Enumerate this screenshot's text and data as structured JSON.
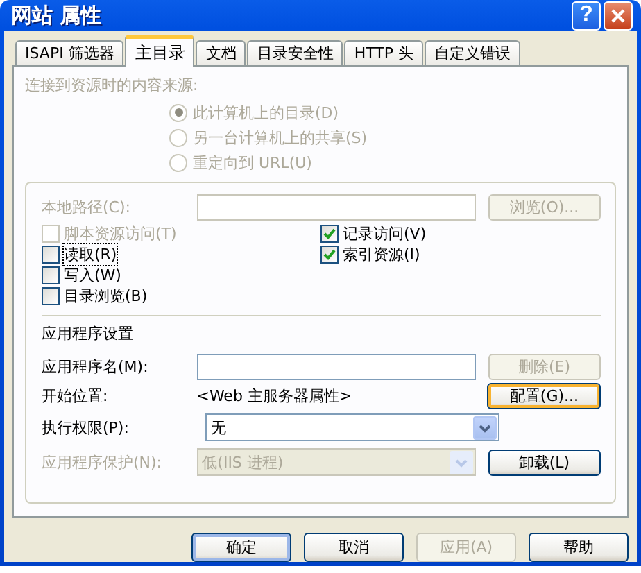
{
  "window": {
    "title": "网站 属性",
    "help_button": "?"
  },
  "tabs": [
    {
      "label": "ISAPI 筛选器",
      "selected": false
    },
    {
      "label": "主目录",
      "selected": true
    },
    {
      "label": "文档",
      "selected": false
    },
    {
      "label": "目录安全性",
      "selected": false
    },
    {
      "label": "HTTP 头",
      "selected": false
    },
    {
      "label": "自定义错误",
      "selected": false
    }
  ],
  "content_source": {
    "label": "连接到资源时的内容来源:",
    "disabled": true,
    "options": [
      {
        "label": "此计算机上的目录(D)",
        "selected": true
      },
      {
        "label": "另一台计算机上的共享(S)",
        "selected": false
      },
      {
        "label": "重定向到 URL(U)",
        "selected": false
      }
    ]
  },
  "local_path": {
    "label": "本地路径(C):",
    "disabled": true,
    "button": {
      "label": "浏览(O)...",
      "disabled": true
    }
  },
  "permissions": {
    "column_1": [
      {
        "label": "脚本资源访问(T)",
        "checked": false,
        "disabled": true,
        "focused": false
      },
      {
        "label": "读取(R)",
        "checked": false,
        "disabled": false,
        "focused": true
      },
      {
        "label": "写入(W)",
        "checked": false,
        "disabled": false,
        "focused": false
      },
      {
        "label": "目录浏览(B)",
        "checked": false,
        "disabled": false,
        "focused": false
      }
    ],
    "column_2": [
      {
        "label": "记录访问(V)",
        "checked": true,
        "disabled": false,
        "focused": false
      },
      {
        "label": "索引资源(I)",
        "checked": true,
        "disabled": false,
        "focused": false
      }
    ]
  },
  "app_settings": {
    "heading": "应用程序设置",
    "app_name": {
      "label": "应用程序名(M):",
      "disabled": false,
      "button": {
        "label": "删除(E)",
        "disabled": true,
        "hover": false
      }
    },
    "start_point": {
      "label": "开始位置:",
      "value": "<Web 主服务器属性>",
      "button": {
        "label": "配置(G)...",
        "disabled": false,
        "hover": true
      }
    },
    "execute": {
      "label": "执行权限(P):",
      "value": "无",
      "disabled": false
    },
    "protection": {
      "label": "应用程序保护(N):",
      "value": "低(IIS 进程)",
      "disabled": true,
      "button": {
        "label": "卸载(L)",
        "disabled": false,
        "hover": false
      }
    }
  },
  "buttons": [
    {
      "label": "确定",
      "default": true,
      "disabled": false
    },
    {
      "label": "取消",
      "default": false,
      "disabled": false
    },
    {
      "label": "应用(A)",
      "default": false,
      "disabled": true
    },
    {
      "label": "帮助",
      "default": false,
      "disabled": false
    }
  ]
}
